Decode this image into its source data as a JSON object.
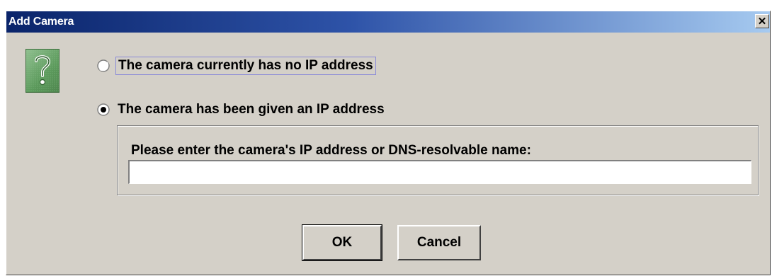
{
  "window": {
    "title": "Add Camera",
    "close_glyph": "✕"
  },
  "icon": {
    "name": "question-icon",
    "glyph": "?"
  },
  "options": [
    {
      "label": "The camera currently has no IP address",
      "selected": false
    },
    {
      "label": "The camera has been given an IP address",
      "selected": true
    }
  ],
  "ip_panel": {
    "prompt": "Please enter the camera's IP address or DNS-resolvable name:",
    "value": "",
    "placeholder": ""
  },
  "buttons": {
    "ok": "OK",
    "cancel": "Cancel"
  }
}
